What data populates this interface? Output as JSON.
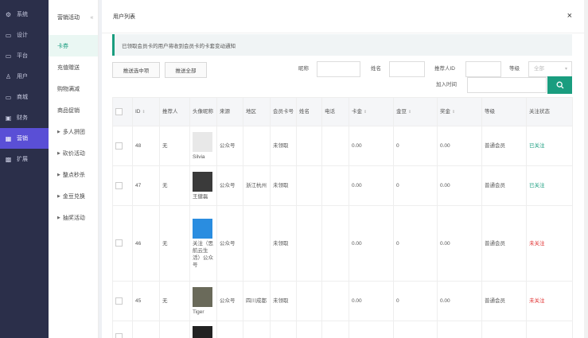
{
  "sidebar": [
    {
      "icon": "settings-icon",
      "label": "系统"
    },
    {
      "icon": "design-icon",
      "label": "设计"
    },
    {
      "icon": "platform-icon",
      "label": "平台"
    },
    {
      "icon": "user-icon",
      "label": "用户"
    },
    {
      "icon": "shop-icon",
      "label": "商城"
    },
    {
      "icon": "finance-icon",
      "label": "财务"
    },
    {
      "icon": "marketing-icon",
      "label": "营销",
      "active": true
    },
    {
      "icon": "extend-icon",
      "label": "扩展"
    }
  ],
  "submenu": {
    "title": "营销活动",
    "collapse": "«",
    "items": [
      {
        "label": "卡券",
        "active": true
      },
      {
        "label": "充值赠送"
      },
      {
        "label": "购物满减"
      },
      {
        "label": "商品促销"
      },
      {
        "label": "多人拼团",
        "expandable": true
      },
      {
        "label": "砍价活动",
        "expandable": true
      },
      {
        "label": "整点秒杀",
        "expandable": true
      },
      {
        "label": "金豆兑换",
        "expandable": true
      },
      {
        "label": "抽奖活动",
        "expandable": true
      }
    ]
  },
  "panel": {
    "title": "用户列表",
    "close": "×",
    "notice": "已领取会员卡的用户将收到会员卡的卡套变动通知"
  },
  "filters": {
    "push_selected": "推送选中项",
    "push_all": "推送全部",
    "nickname_label": "昵称",
    "name_label": "姓名",
    "referrer_label": "推荐人ID",
    "level_label": "等级",
    "level_value": "全部",
    "join_time_label": "加入时间"
  },
  "table": {
    "headers": [
      "",
      "ID",
      "推荐人",
      "头像昵称",
      "来源",
      "地区",
      "会员卡号",
      "姓名",
      "电话",
      "卡金",
      "金豆",
      "奖金",
      "等级",
      "关注状态"
    ],
    "rows": [
      {
        "id": "48",
        "referrer": "无",
        "nickname": "Silvia",
        "source": "公众号",
        "region": "",
        "card": "未领取",
        "name": "",
        "phone": "",
        "card_balance": "0.00",
        "beans": "0",
        "bonus": "0.00",
        "level": "普通会员",
        "follow": "已关注",
        "followed": true,
        "avatar": "#e8e8e8"
      },
      {
        "id": "47",
        "referrer": "无",
        "nickname": "王健磊",
        "source": "公众号",
        "region": "浙江杭州",
        "card": "未领取",
        "name": "",
        "phone": "",
        "card_balance": "0.00",
        "beans": "0",
        "bonus": "0.00",
        "level": "普通会员",
        "follow": "已关注",
        "followed": true,
        "avatar": "#3a3a3a"
      },
      {
        "id": "46",
        "referrer": "无",
        "nickname": "关注（思航云生活）公众号",
        "source": "公众号",
        "region": "",
        "card": "未领取",
        "name": "",
        "phone": "",
        "card_balance": "0.00",
        "beans": "0",
        "bonus": "0.00",
        "level": "普通会员",
        "follow": "未关注",
        "followed": false,
        "avatar": "#2a8de0"
      },
      {
        "id": "45",
        "referrer": "无",
        "nickname": "Tiger",
        "source": "公众号",
        "region": "四川成都",
        "card": "未领取",
        "name": "",
        "phone": "",
        "card_balance": "0.00",
        "beans": "0",
        "bonus": "0.00",
        "level": "普通会员",
        "follow": "未关注",
        "followed": false,
        "avatar": "#6a6a5a"
      },
      {
        "id": "",
        "referrer": "",
        "nickname": "",
        "source": "",
        "region": "",
        "card": "",
        "name": "",
        "phone": "",
        "card_balance": "",
        "beans": "",
        "bonus": "",
        "level": "",
        "follow": "",
        "followed": false,
        "avatar": "#222"
      }
    ]
  },
  "colors": {
    "accent": "#1a9d7f",
    "sidebar": "#2b2f4a",
    "active": "#5a4fd6",
    "unfollowed": "#e03030"
  }
}
